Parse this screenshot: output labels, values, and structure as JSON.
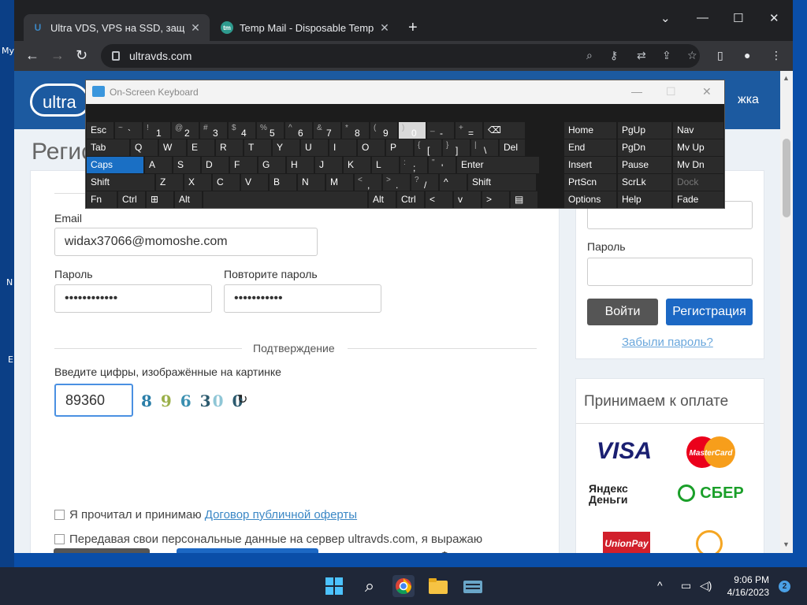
{
  "desktop": {
    "labels": [
      "My",
      "N",
      "E"
    ]
  },
  "browser": {
    "tabs": [
      {
        "title": "Ultra VDS, VPS на SSD, защита о",
        "favicon": "U",
        "active": true
      },
      {
        "title": "Temp Mail - Disposable Tempora",
        "favicon": "tm",
        "active": false
      }
    ],
    "new_tab": "+",
    "controls": {
      "minimize": "—",
      "maximize": "☐",
      "close": "✕",
      "dropdown": "⌄"
    },
    "nav": {
      "back": "←",
      "forward": "→",
      "reload": "↻"
    },
    "url": "ultravds.com",
    "omni_icons": [
      "search-icon",
      "key-icon",
      "translate-icon",
      "share-icon",
      "star-icon"
    ]
  },
  "site": {
    "logo_text": "ultra",
    "header_link": "жка",
    "page_title": "Регис",
    "form": {
      "email_label": "Email",
      "email_value": "widax37066@momoshe.com",
      "password_label": "Пароль",
      "password_value": "••••••••••••",
      "repeat_label": "Повторите пароль",
      "repeat_value": "•••••••••••",
      "confirm_section": "Подтверждение",
      "captcha_label": "Введите цифры, изображённые на картинке",
      "captcha_value": "89360",
      "captcha_image": "8 9 6 3 0 0",
      "agree_text": "Я прочитал и принимаю ",
      "agree_link": "Договор публичной оферты",
      "consent_text": "Передавая свои персональные данные на сервер ultravds.com, я выражаю согласие на их последующую обработку и хранение в соответствии с Федеральным законом Российской Федерации N152-ФЗ «О персональных данных»"
    },
    "login": {
      "password_label": "Пароль",
      "login_button": "Войти",
      "register_button": "Регистрация",
      "forgot_link": "Забыли пароль?"
    },
    "payments": {
      "title": "Принимаем к оплате",
      "logos": [
        "VISA",
        "MasterCard",
        "Яндекс Деньги",
        "СБЕР",
        "UnionPay"
      ]
    }
  },
  "osk": {
    "title": "On-Screen Keyboard",
    "controls": {
      "minimize": "—",
      "maximize": "☐",
      "close": "✕"
    },
    "rows": [
      [
        {
          "l": "Esc"
        },
        {
          "s": "~",
          "m": "`"
        },
        {
          "s": "!",
          "m": "1"
        },
        {
          "s": "@",
          "m": "2"
        },
        {
          "s": "#",
          "m": "3"
        },
        {
          "s": "$",
          "m": "4"
        },
        {
          "s": "%",
          "m": "5"
        },
        {
          "s": "^",
          "m": "6"
        },
        {
          "s": "&",
          "m": "7"
        },
        {
          "s": "*",
          "m": "8"
        },
        {
          "s": "(",
          "m": "9"
        },
        {
          "s": ")",
          "m": "0"
        },
        {
          "s": "_",
          "m": "-"
        },
        {
          "s": "+",
          "m": "="
        },
        {
          "l": "⌫"
        }
      ],
      [
        {
          "l": "Tab"
        },
        {
          "l": "Q"
        },
        {
          "l": "W"
        },
        {
          "l": "E"
        },
        {
          "l": "R"
        },
        {
          "l": "T"
        },
        {
          "l": "Y"
        },
        {
          "l": "U"
        },
        {
          "l": "I"
        },
        {
          "l": "O"
        },
        {
          "l": "P"
        },
        {
          "s": "{",
          "m": "["
        },
        {
          "s": "}",
          "m": "]"
        },
        {
          "s": "|",
          "m": "\\"
        },
        {
          "l": "Del"
        }
      ],
      [
        {
          "l": "Caps"
        },
        {
          "l": "A"
        },
        {
          "l": "S"
        },
        {
          "l": "D"
        },
        {
          "l": "F"
        },
        {
          "l": "G"
        },
        {
          "l": "H"
        },
        {
          "l": "J"
        },
        {
          "l": "K"
        },
        {
          "l": "L"
        },
        {
          "s": ":",
          "m": ";"
        },
        {
          "s": "\"",
          "m": "'"
        },
        {
          "l": "Enter"
        }
      ],
      [
        {
          "l": "Shift"
        },
        {
          "l": "Z"
        },
        {
          "l": "X"
        },
        {
          "l": "C"
        },
        {
          "l": "V"
        },
        {
          "l": "B"
        },
        {
          "l": "N"
        },
        {
          "l": "M"
        },
        {
          "s": "<",
          "m": ","
        },
        {
          "s": ">",
          "m": "."
        },
        {
          "s": "?",
          "m": "/"
        },
        {
          "l": "^"
        },
        {
          "l": "Shift"
        }
      ],
      [
        {
          "l": "Fn"
        },
        {
          "l": "Ctrl"
        },
        {
          "l": "⊞"
        },
        {
          "l": "Alt"
        },
        {
          "l": ""
        },
        {
          "l": "Alt"
        },
        {
          "l": "Ctrl"
        },
        {
          "l": "<"
        },
        {
          "l": "v"
        },
        {
          "l": ">"
        },
        {
          "l": "▤"
        }
      ]
    ],
    "nav": [
      [
        "Home",
        "PgUp",
        "Nav"
      ],
      [
        "End",
        "PgDn",
        "Mv Up"
      ],
      [
        "Insert",
        "Pause",
        "Mv Dn"
      ],
      [
        "PrtScn",
        "ScrLk",
        "Dock"
      ],
      [
        "Options",
        "Help",
        "Fade"
      ]
    ]
  },
  "taskbar": {
    "apps": [
      "windows-start-icon",
      "search-icon",
      "chrome-icon",
      "file-explorer-icon",
      "osk-icon"
    ],
    "tray": {
      "chevron": "^"
    },
    "time": "9:06 PM",
    "date": "4/16/2023",
    "notifications": "2"
  }
}
